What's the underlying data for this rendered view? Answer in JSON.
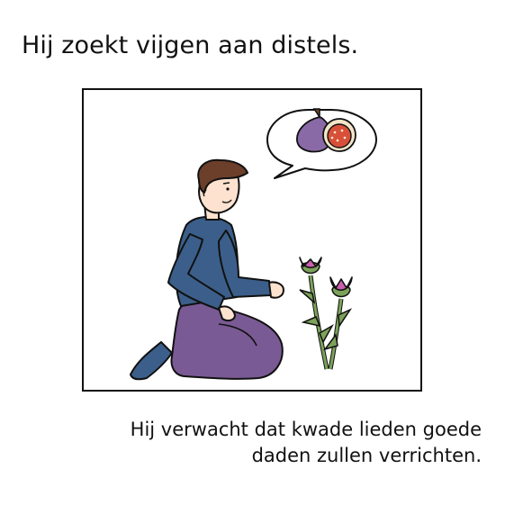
{
  "title": "Hij zoekt vijgen aan distels.",
  "caption": {
    "line1": "Hij verwacht dat kwade lieden goede",
    "line2": "daden zullen verrichten."
  },
  "illustration": {
    "subject": "kneeling-man",
    "thought": "figs",
    "plant": "thistles"
  },
  "colors": {
    "shirt": "#3b5f8a",
    "pants": "#7a5a94",
    "hair": "#6b3f2a",
    "skin": "#fde3cf",
    "fig_skin": "#8a6aa6",
    "fig_flesh": "#d9503a",
    "thistle_flower": "#c95fae",
    "stem": "#7ca25a"
  }
}
